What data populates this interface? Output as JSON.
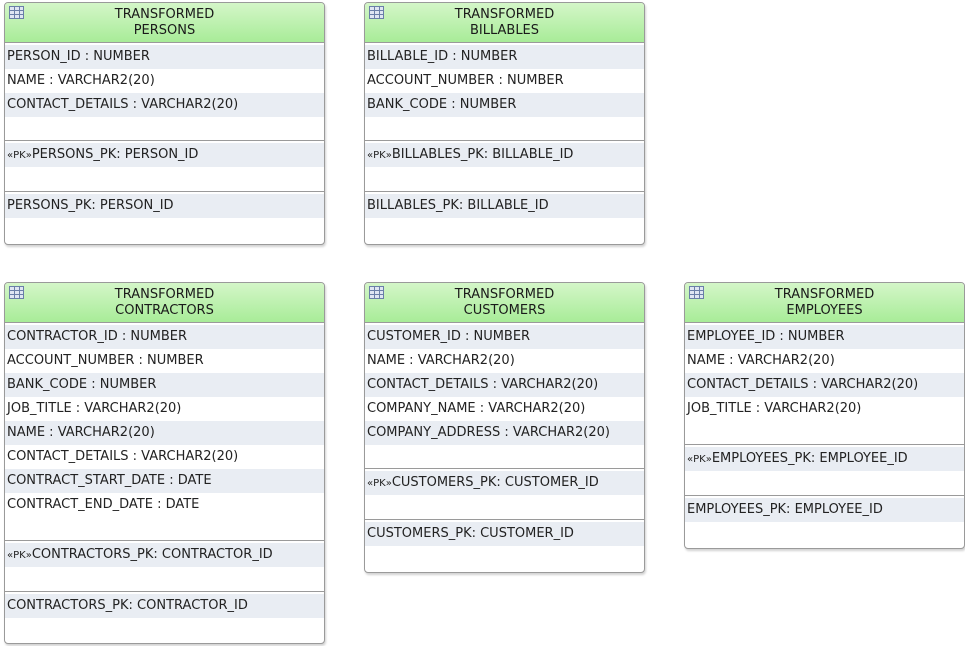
{
  "tables": {
    "persons": {
      "title_line1": "TRANSFORMED",
      "title_line2": "PERSONS",
      "columns": [
        "PERSON_ID : NUMBER",
        "NAME : VARCHAR2(20)",
        "CONTACT_DETAILS : VARCHAR2(20)"
      ],
      "pk_marker": "«PK»",
      "pk": "PERSONS_PK: PERSON_ID",
      "index": "PERSONS_PK: PERSON_ID"
    },
    "billables": {
      "title_line1": "TRANSFORMED",
      "title_line2": "BILLABLES",
      "columns": [
        "BILLABLE_ID : NUMBER",
        "ACCOUNT_NUMBER : NUMBER",
        "BANK_CODE : NUMBER"
      ],
      "pk_marker": "«PK»",
      "pk": "BILLABLES_PK: BILLABLE_ID",
      "index": "BILLABLES_PK: BILLABLE_ID"
    },
    "contractors": {
      "title_line1": "TRANSFORMED",
      "title_line2": "CONTRACTORS",
      "columns": [
        "CONTRACTOR_ID : NUMBER",
        "ACCOUNT_NUMBER : NUMBER",
        "BANK_CODE : NUMBER",
        "JOB_TITLE : VARCHAR2(20)",
        "NAME : VARCHAR2(20)",
        "CONTACT_DETAILS : VARCHAR2(20)",
        "CONTRACT_START_DATE : DATE",
        "CONTRACT_END_DATE : DATE"
      ],
      "pk_marker": "«PK»",
      "pk": "CONTRACTORS_PK: CONTRACTOR_ID",
      "index": "CONTRACTORS_PK: CONTRACTOR_ID"
    },
    "customers": {
      "title_line1": "TRANSFORMED",
      "title_line2": "CUSTOMERS",
      "columns": [
        "CUSTOMER_ID : NUMBER",
        "NAME : VARCHAR2(20)",
        "CONTACT_DETAILS : VARCHAR2(20)",
        "COMPANY_NAME : VARCHAR2(20)",
        "COMPANY_ADDRESS : VARCHAR2(20)"
      ],
      "pk_marker": "«PK»",
      "pk": "CUSTOMERS_PK: CUSTOMER_ID",
      "index": "CUSTOMERS_PK: CUSTOMER_ID"
    },
    "employees": {
      "title_line1": "TRANSFORMED",
      "title_line2": "EMPLOYEES",
      "columns": [
        "EMPLOYEE_ID : NUMBER",
        "NAME : VARCHAR2(20)",
        "CONTACT_DETAILS : VARCHAR2(20)",
        "JOB_TITLE : VARCHAR2(20)"
      ],
      "pk_marker": "«PK»",
      "pk": "EMPLOYEES_PK: EMPLOYEE_ID",
      "index": "EMPLOYEES_PK: EMPLOYEE_ID"
    }
  },
  "colors": {
    "header_green_top": "#d4f6c8",
    "header_green_bottom": "#a8ec98",
    "row_shade": "#e9edf3",
    "border": "#9a9a9a"
  },
  "icons": {
    "table_header": "table-grid-icon"
  }
}
